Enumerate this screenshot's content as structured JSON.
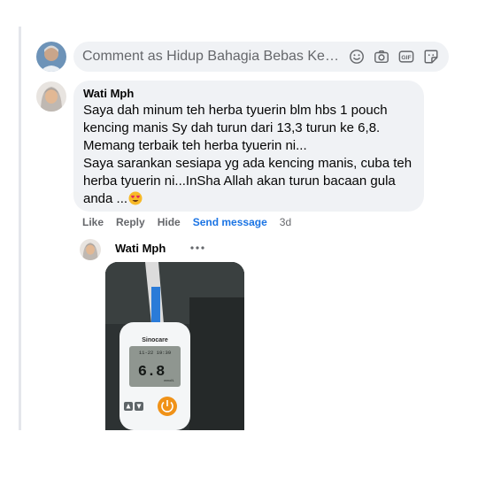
{
  "composer": {
    "placeholder": "Comment as Hidup Bahagia Bebas Kenci…",
    "icons": [
      "emoji-icon",
      "camera-icon",
      "gif-icon",
      "sticker-icon"
    ]
  },
  "comment": {
    "author": "Wati Mph",
    "lines": [
      "Saya dah minum teh herba tyuerin blm hbs 1 pouch",
      "kencing manis Sy dah turun dari 13,3 turun ke 6,8.",
      "Memang terbaik teh herba tyuerin ni...",
      "Saya sarankan sesiapa yg ada kencing manis, cuba teh",
      "herba tyuerin ni...InSha Allah akan turun bacaan gula",
      "anda ..."
    ],
    "emoji": "heart-eyes-icon"
  },
  "actions": {
    "like": "Like",
    "reply": "Reply",
    "hide": "Hide",
    "send_message": "Send message",
    "time": "3d"
  },
  "reply": {
    "author": "Wati Mph"
  },
  "photo": {
    "brand": "Sinocare",
    "reading": "6.8",
    "unit": "mmol/L",
    "datetime": "11-22 19:39"
  },
  "colors": {
    "bubble": "#f0f2f5",
    "link": "#1b74e4",
    "muted": "#65676b"
  }
}
